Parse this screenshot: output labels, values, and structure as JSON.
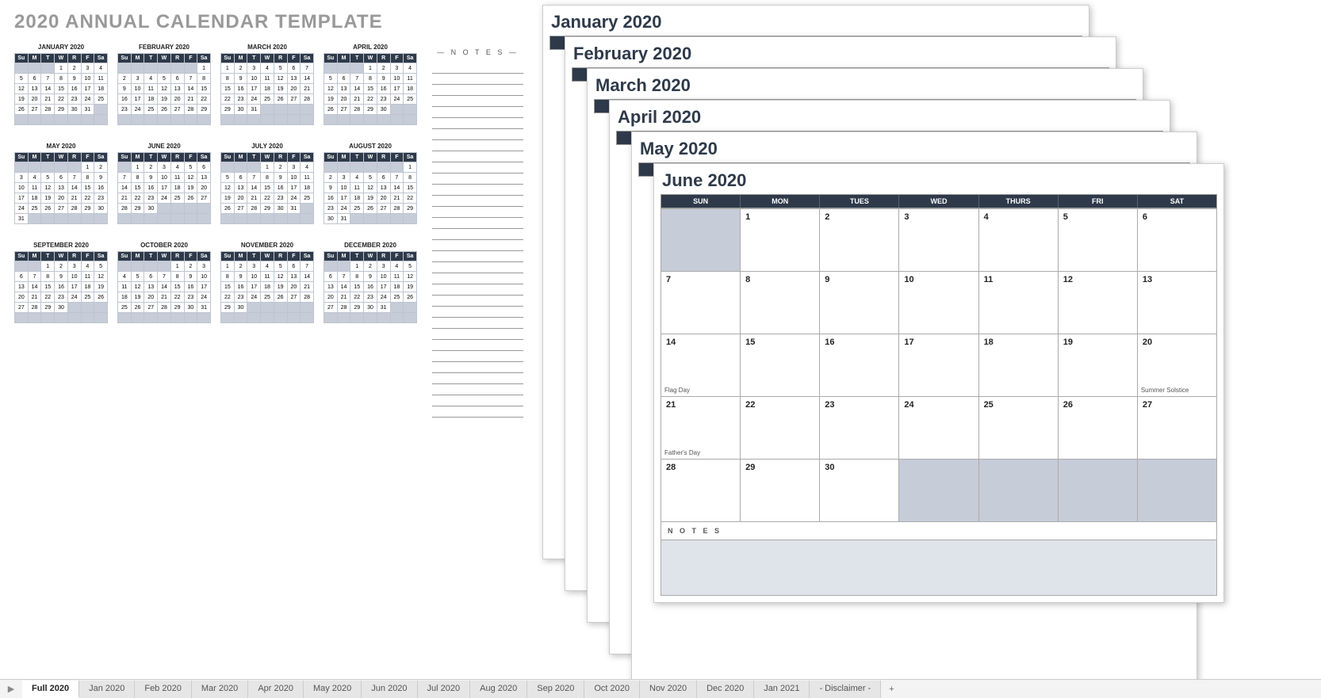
{
  "title": "2020 ANNUAL CALENDAR TEMPLATE",
  "dayHeadersShort": [
    "Su",
    "M",
    "T",
    "W",
    "R",
    "F",
    "Sa"
  ],
  "dayHeadersLong": [
    "SUN",
    "MON",
    "TUES",
    "WED",
    "THURS",
    "FRI",
    "SAT"
  ],
  "notesLabel": "— N O T E S —",
  "bigNotesLabel": "N O T E S",
  "miniMonths": [
    {
      "title": "JANUARY 2020",
      "start": 3,
      "days": 31
    },
    {
      "title": "FEBRUARY 2020",
      "start": 6,
      "days": 29
    },
    {
      "title": "MARCH 2020",
      "start": 0,
      "days": 31
    },
    {
      "title": "APRIL 2020",
      "start": 3,
      "days": 30
    },
    {
      "title": "MAY 2020",
      "start": 5,
      "days": 31
    },
    {
      "title": "JUNE 2020",
      "start": 1,
      "days": 30
    },
    {
      "title": "JULY 2020",
      "start": 3,
      "days": 31
    },
    {
      "title": "AUGUST 2020",
      "start": 6,
      "days": 31
    },
    {
      "title": "SEPTEMBER 2020",
      "start": 2,
      "days": 30
    },
    {
      "title": "OCTOBER 2020",
      "start": 4,
      "days": 31
    },
    {
      "title": "NOVEMBER 2020",
      "start": 0,
      "days": 30
    },
    {
      "title": "DECEMBER 2020",
      "start": 2,
      "days": 31
    }
  ],
  "stackedMonths": [
    {
      "title": "January 2020"
    },
    {
      "title": "February 2020"
    },
    {
      "title": "March 2020"
    },
    {
      "title": "April 2020"
    },
    {
      "title": "May 2020"
    }
  ],
  "topMonth": {
    "title": "June 2020",
    "start": 1,
    "days": 30,
    "events": {
      "14": "Flag Day",
      "20": "Summer Solstice",
      "21": "Father's Day"
    }
  },
  "tabs": [
    "Full 2020",
    "Jan 2020",
    "Feb 2020",
    "Mar 2020",
    "Apr 2020",
    "May 2020",
    "Jun 2020",
    "Jul 2020",
    "Aug 2020",
    "Sep 2020",
    "Oct 2020",
    "Nov 2020",
    "Dec 2020",
    "Jan 2021",
    "- Disclaimer -"
  ],
  "activeTab": "Full 2020"
}
